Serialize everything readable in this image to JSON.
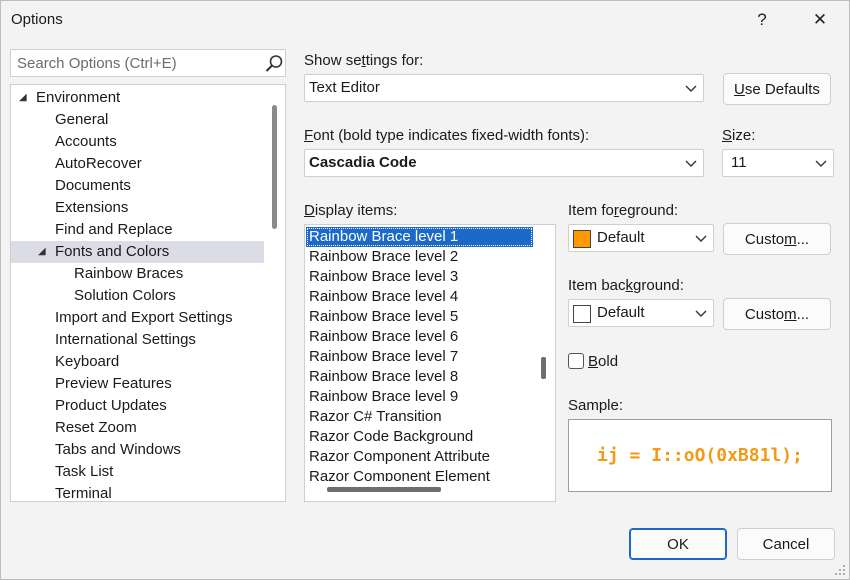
{
  "window": {
    "title": "Options",
    "help_label": "?",
    "close_label": "✕"
  },
  "search": {
    "placeholder": "Search Options (Ctrl+E)"
  },
  "tree": {
    "items": [
      {
        "label": "Environment",
        "level": 0,
        "expanded": true
      },
      {
        "label": "General",
        "level": 1
      },
      {
        "label": "Accounts",
        "level": 1
      },
      {
        "label": "AutoRecover",
        "level": 1
      },
      {
        "label": "Documents",
        "level": 1
      },
      {
        "label": "Extensions",
        "level": 1
      },
      {
        "label": "Find and Replace",
        "level": 1
      },
      {
        "label": "Fonts and Colors",
        "level": 1,
        "expanded": true,
        "selected": true
      },
      {
        "label": "Rainbow Braces",
        "level": 2
      },
      {
        "label": "Solution Colors",
        "level": 2
      },
      {
        "label": "Import and Export Settings",
        "level": 1
      },
      {
        "label": "International Settings",
        "level": 1
      },
      {
        "label": "Keyboard",
        "level": 1
      },
      {
        "label": "Preview Features",
        "level": 1
      },
      {
        "label": "Product Updates",
        "level": 1
      },
      {
        "label": "Reset Zoom",
        "level": 1
      },
      {
        "label": "Tabs and Windows",
        "level": 1
      },
      {
        "label": "Task List",
        "level": 1
      },
      {
        "label": "Terminal",
        "level": 1
      }
    ]
  },
  "settings": {
    "show_label_pre": "Show se",
    "show_label_key": "t",
    "show_label_post": "tings for:",
    "show_value": "Text Editor",
    "use_defaults_key": "U",
    "use_defaults_rest": "se Defaults",
    "font_label_key": "F",
    "font_label_rest": "ont (bold type indicates fixed-width fonts):",
    "font_value": "Cascadia Code",
    "size_label_pre": "",
    "size_label_key": "S",
    "size_label_rest": "ize:",
    "size_value": "11"
  },
  "display_items": {
    "label_key": "D",
    "label_rest": "isplay items:",
    "items": [
      "Rainbow Brace level 1",
      "Rainbow Brace level 2",
      "Rainbow Brace level 3",
      "Rainbow Brace level 4",
      "Rainbow Brace level 5",
      "Rainbow Brace level 6",
      "Rainbow Brace level 7",
      "Rainbow Brace level 8",
      "Rainbow Brace level 9",
      "Razor C# Transition",
      "Razor Code Background",
      "Razor Component Attribute",
      "Razor Component Element"
    ],
    "selected_index": 0
  },
  "foreground": {
    "label_pre": "Item fo",
    "label_key": "r",
    "label_post": "eground:",
    "value": "Default",
    "swatch_color": "#ff9900",
    "custom_pre": "Custo",
    "custom_key": "m",
    "custom_post": "..."
  },
  "background": {
    "label_pre": "Item bac",
    "label_key": "k",
    "label_post": "ground:",
    "value": "Default",
    "swatch_color": "#ffffff",
    "custom_pre": "Custo",
    "custom_key": "m",
    "custom_post": "..."
  },
  "bold": {
    "label_key": "B",
    "label_rest": "old",
    "checked": false
  },
  "sample": {
    "label": "Sample:",
    "text": "ij = I::oO(0xB81l);",
    "color": "#f29b16"
  },
  "footer": {
    "ok_label": "OK",
    "cancel_label": "Cancel"
  },
  "colors": {
    "selection": "#1b6ac9",
    "tree_selection": "#dcdce6",
    "dialog_bg": "#f3f3f3"
  }
}
